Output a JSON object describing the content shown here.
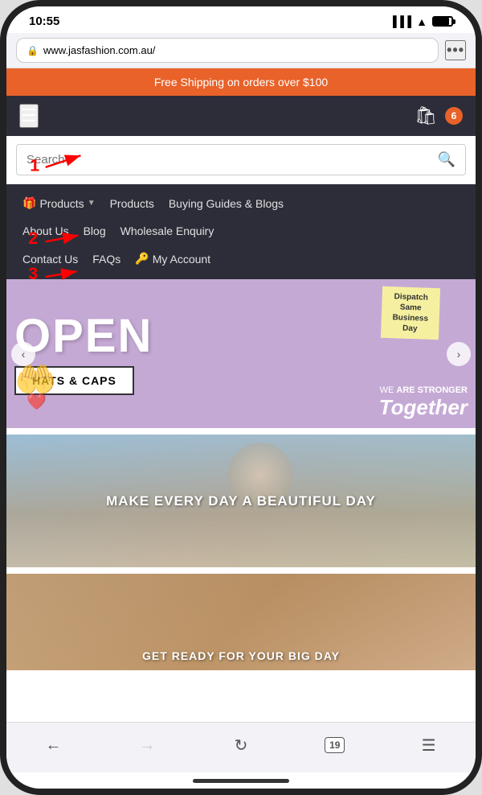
{
  "statusBar": {
    "time": "10:55",
    "timeArrow": "↗"
  },
  "browser": {
    "url": "www.jasfashion.com.au/",
    "dots": "•••"
  },
  "promoBanner": {
    "text": "Free Shipping on orders over $100"
  },
  "navHeader": {
    "cartCount": "6"
  },
  "search": {
    "placeholder": "Search",
    "buttonIcon": "🔍"
  },
  "navMenu": {
    "row1": [
      {
        "label": "Products",
        "hasIcon": true,
        "hasDropdown": true
      },
      {
        "label": "Products",
        "hasIcon": false,
        "hasDropdown": false
      },
      {
        "label": "Buying Guides & Blogs",
        "hasIcon": false,
        "hasDropdown": false
      }
    ],
    "row2": [
      {
        "label": "About Us"
      },
      {
        "label": "Blog"
      },
      {
        "label": "Wholesale Enquiry"
      }
    ],
    "row3": [
      {
        "label": "Contact Us"
      },
      {
        "label": "FAQs"
      },
      {
        "label": "My Account",
        "hasKeyIcon": true
      }
    ]
  },
  "hero": {
    "openText": "OPEN",
    "dispatchText": "Dispatch\nSame\nBusiness\nDay",
    "hatsLabel": "HATS & CAPS",
    "weAreText": "WE ARE STRONGER",
    "togetherText": "Together"
  },
  "banner2": {
    "text": "MAKE EVERY DAY A BEAUTIFUL DAY"
  },
  "banner3": {
    "text": "GET READY FOR YOUR BIG DAY"
  },
  "bottomBar": {
    "tabsCount": "19"
  },
  "annotations": {
    "label1": "1",
    "label2": "2",
    "label3": "3"
  }
}
